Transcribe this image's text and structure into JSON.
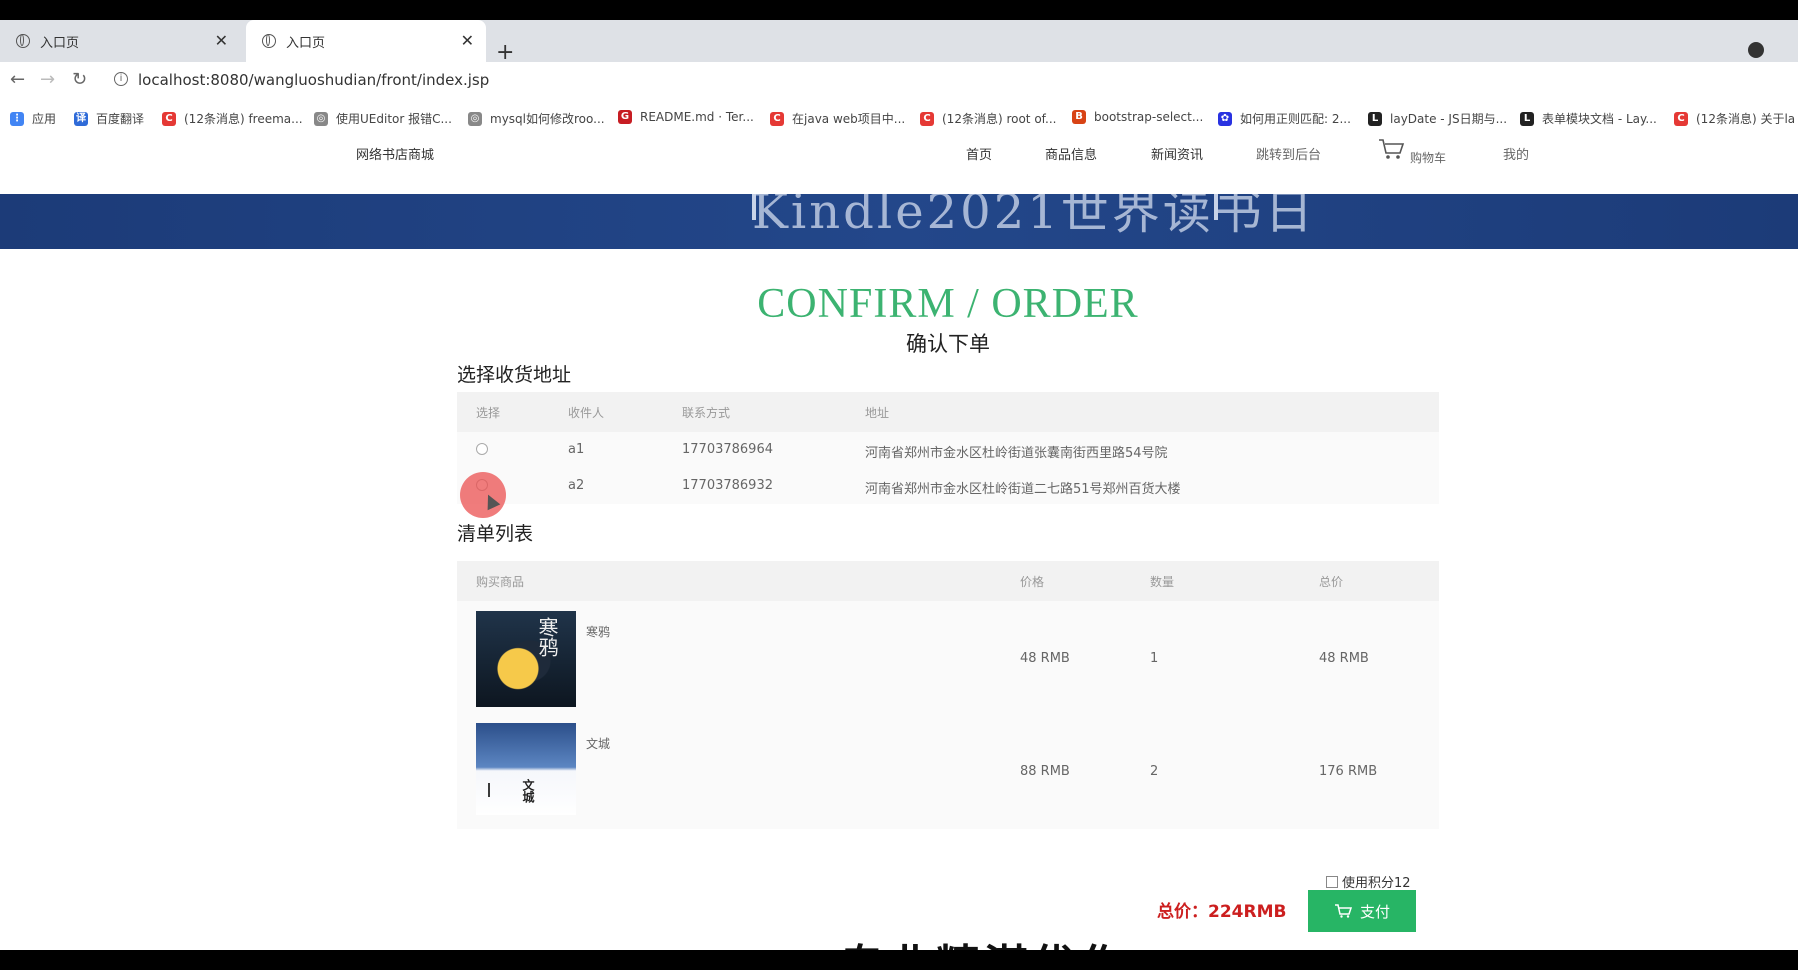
{
  "browser": {
    "tabs": [
      {
        "title": "入口页",
        "active": false
      },
      {
        "title": "入口页",
        "active": true
      }
    ],
    "url": "localhost:8080/wangluoshudian/front/index.jsp",
    "bookmarks": [
      {
        "label": "应用",
        "icon": "apps-grid-icon",
        "color": "#4285f4"
      },
      {
        "label": "百度翻译",
        "icon": "baidu-translate-icon",
        "color": "#2f6bd8"
      },
      {
        "label": "(12条消息) freema...",
        "icon": "csdn-icon",
        "color": "#e53935"
      },
      {
        "label": "使用UEditor 报错C...",
        "icon": "globe-icon",
        "color": "#666666"
      },
      {
        "label": "mysql如何修改roo...",
        "icon": "globe-icon",
        "color": "#666666"
      },
      {
        "label": "README.md · Ter...",
        "icon": "gitee-icon",
        "color": "#c71d23"
      },
      {
        "label": "在java web项目中...",
        "icon": "csdn-icon",
        "color": "#e53935"
      },
      {
        "label": "(12条消息) root of...",
        "icon": "csdn-icon",
        "color": "#e53935"
      },
      {
        "label": "bootstrap-select...",
        "icon": "book-icon",
        "color": "#d84315"
      },
      {
        "label": "如何用正则匹配: 2...",
        "icon": "baidu-icon",
        "color": "#2932e1"
      },
      {
        "label": "layDate - JS日期与...",
        "icon": "layui-icon",
        "color": "#222222"
      },
      {
        "label": "表单模块文档 - Lay...",
        "icon": "layui-icon",
        "color": "#222222"
      },
      {
        "label": "(12条消息) 关于la",
        "icon": "csdn-icon",
        "color": "#e53935"
      }
    ]
  },
  "site": {
    "brand": "网络书店商城",
    "nav": [
      "首页",
      "商品信息",
      "新闻资讯",
      "跳转到后台"
    ],
    "cart_label": "购物车",
    "mine_label": "我的",
    "banner_text": "Kindle2021世界读书日"
  },
  "page": {
    "title_en": "CONFIRM / ORDER",
    "title_cn": "确认下单",
    "address_section_title": "选择收货地址",
    "address_headers": [
      "选择",
      "收件人",
      "联系方式",
      "地址"
    ],
    "addresses": [
      {
        "name": "a1",
        "phone": "17703786964",
        "address": "河南省郑州市金水区杜岭街道张囊南街西里路54号院"
      },
      {
        "name": "a2",
        "phone": "17703786932",
        "address": "河南省郑州市金水区杜岭街道二七路51号郑州百货大楼"
      }
    ],
    "list_section_title": "清单列表",
    "list_headers": [
      "购买商品",
      "价格",
      "数量",
      "总价"
    ],
    "items": [
      {
        "name": "寒鸦",
        "cover_text": "寒鸦",
        "price": "48 RMB",
        "qty": "1",
        "total": "48 RMB"
      },
      {
        "name": "文城",
        "cover_text": "文城",
        "price": "88 RMB",
        "qty": "2",
        "total": "176 RMB"
      }
    ],
    "points_label": "使用积分12",
    "total_label": "总价：224RMB",
    "pay_label": "支付",
    "footer_peek": "专业精湛优作"
  },
  "colors": {
    "accent_green": "#3cb371",
    "pay_button": "#27b565",
    "total_red": "#cc1f1f",
    "banner_blue": "#1c3b78"
  }
}
